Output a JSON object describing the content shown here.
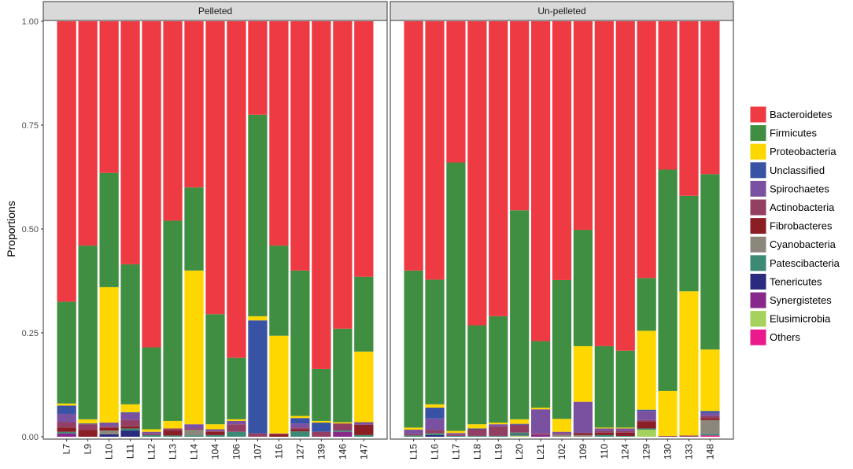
{
  "chart_data": {
    "type": "bar",
    "stacked": true,
    "ylabel": "Proportions",
    "xlabel": "",
    "ylim": [
      0,
      1
    ],
    "yticks": [
      "0.00",
      "0.25",
      "0.50",
      "0.75",
      "1.00"
    ],
    "grid": false,
    "legend_position": "right",
    "legend": [
      "Bacteroidetes",
      "Firmicutes",
      "Proteobacteria",
      "Unclassified",
      "Spirochaetes",
      "Actinobacteria",
      "Fibrobacteres",
      "Cyanobacteria",
      "Patescibacteria",
      "Tenericutes",
      "Synergistetes",
      "Elusimicrobia",
      "Others"
    ],
    "colors": {
      "Bacteroidetes": "#EE3A43",
      "Firmicutes": "#3F8E41",
      "Proteobacteria": "#FFD700",
      "Unclassified": "#3852A4",
      "Spirochaetes": "#7A51A1",
      "Actinobacteria": "#923F63",
      "Fibrobacteres": "#8A1E24",
      "Cyanobacteria": "#8C877D",
      "Patescibacteria": "#3C8A76",
      "Tenericutes": "#2A2A7E",
      "Synergistetes": "#87288A",
      "Elusimicrobia": "#A5D25C",
      "Others": "#EB1A8C"
    },
    "panels": [
      {
        "title": "Pelleted",
        "categories": [
          "L7",
          "L9",
          "L10",
          "L11",
          "L12",
          "L13",
          "L14",
          "104",
          "106",
          "107",
          "116",
          "127",
          "139",
          "146",
          "147"
        ],
        "series": [
          {
            "name": "Bacteroidetes",
            "values": [
              0.675,
              0.54,
              0.365,
              0.585,
              0.785,
              0.48,
              0.4,
              0.705,
              0.81,
              0.225,
              0.54,
              0.6,
              0.837,
              0.74,
              0.615
            ]
          },
          {
            "name": "Firmicutes",
            "values": [
              0.245,
              0.418,
              0.275,
              0.337,
              0.197,
              0.482,
              0.2,
              0.265,
              0.148,
              0.485,
              0.217,
              0.35,
              0.125,
              0.225,
              0.18
            ]
          },
          {
            "name": "Proteobacteria",
            "values": [
              0.005,
              0.01,
              0.326,
              0.019,
              0.006,
              0.018,
              0.37,
              0.012,
              0.004,
              0.01,
              0.235,
              0.005,
              0.004,
              0.003,
              0.17
            ]
          },
          {
            "name": "Unclassified",
            "values": [
              0.02,
              0.002,
              0,
              0.002,
              0,
              0,
              0,
              0,
              0,
              0.272,
              0,
              0.013,
              0.022,
              0,
              0
            ]
          },
          {
            "name": "Spirochaetes",
            "values": [
              0.02,
              0,
              0.009,
              0.017,
              0.004,
              0,
              0.01,
              0.004,
              0.008,
              0,
              0,
              0.01,
              0,
              0,
              0.006
            ]
          },
          {
            "name": "Actinobacteria",
            "values": [
              0.013,
              0.014,
              0.004,
              0.015,
              0.004,
              0.005,
              0.003,
              0.002,
              0.018,
              0.008,
              0.002,
              0.005,
              0.012,
              0.017,
              0
            ]
          },
          {
            "name": "Fibrobacteres",
            "values": [
              0.01,
              0.016,
              0.006,
              0.005,
              0,
              0.012,
              0,
              0.008,
              0,
              0,
              0.006,
              0.004,
              0,
              0,
              0.025
            ]
          },
          {
            "name": "Cyanobacteria",
            "values": [
              0,
              0,
              0.009,
              0,
              0,
              0,
              0.014,
              0,
              0,
              0,
              0,
              0,
              0,
              0,
              0
            ]
          },
          {
            "name": "Patescibacteria",
            "values": [
              0.004,
              0,
              0,
              0.005,
              0.004,
              0.003,
              0.003,
              0.004,
              0.012,
              0,
              0,
              0.013,
              0,
              0.003,
              0.004
            ]
          },
          {
            "name": "Tenericutes",
            "values": [
              0,
              0,
              0.006,
              0.015,
              0,
              0,
              0,
              0,
              0,
              0,
              0,
              0,
              0,
              0,
              0
            ]
          },
          {
            "name": "Synergistetes",
            "values": [
              0.008,
              0,
              0,
              0,
              0,
              0,
              0,
              0,
              0,
              0,
              0,
              0,
              0,
              0.012,
              0
            ]
          },
          {
            "name": "Elusimicrobia",
            "values": [
              0,
              0,
              0,
              0,
              0,
              0,
              0,
              0,
              0,
              0,
              0,
              0,
              0,
              0,
              0
            ]
          },
          {
            "name": "Others",
            "values": [
              0,
              0,
              0,
              0,
              0,
              0,
              0,
              0,
              0,
              0,
              0,
              0,
              0,
              0,
              0
            ]
          }
        ]
      },
      {
        "title": "Un-pelleted",
        "categories": [
          "L15",
          "L16",
          "L17",
          "L18",
          "L19",
          "L20",
          "L21",
          "102",
          "109",
          "110",
          "124",
          "129",
          "130",
          "133",
          "148"
        ],
        "series": [
          {
            "name": "Bacteroidetes",
            "values": [
              0.6,
              0.622,
              0.34,
              0.732,
              0.71,
              0.455,
              0.77,
              0.623,
              0.502,
              0.782,
              0.793,
              0.618,
              0.357,
              0.42,
              0.368
            ]
          },
          {
            "name": "Firmicutes",
            "values": [
              0.378,
              0.3,
              0.646,
              0.238,
              0.256,
              0.503,
              0.16,
              0.334,
              0.28,
              0.196,
              0.185,
              0.127,
              0.533,
              0.23,
              0.422
            ]
          },
          {
            "name": "Proteobacteria",
            "values": [
              0.005,
              0.008,
              0.005,
              0.01,
              0.004,
              0.011,
              0.004,
              0.031,
              0.134,
              0.002,
              0.002,
              0.19,
              0.108,
              0.347,
              0.148
            ]
          },
          {
            "name": "Unclassified",
            "values": [
              0,
              0.026,
              0,
              0.002,
              0,
              0.002,
              0,
              0,
              0,
              0,
              0,
              0.003,
              0,
              0,
              0.005
            ]
          },
          {
            "name": "Spirochaetes",
            "values": [
              0.01,
              0.028,
              0.004,
              0,
              0.005,
              0,
              0.058,
              0.004,
              0.075,
              0.006,
              0.006,
              0.022,
              0,
              0,
              0.007
            ]
          },
          {
            "name": "Actinobacteria",
            "values": [
              0.004,
              0.008,
              0.003,
              0.016,
              0.023,
              0.019,
              0.004,
              0.003,
              0,
              0.004,
              0.004,
              0.004,
              0.002,
              0.003,
              0.005
            ]
          },
          {
            "name": "Fibrobacteres",
            "values": [
              0,
              0,
              0,
              0,
              0,
              0,
              0,
              0,
              0.005,
              0.006,
              0.008,
              0.016,
              0,
              0,
              0.005
            ]
          },
          {
            "name": "Cyanobacteria",
            "values": [
              0,
              0,
              0,
              0,
              0,
              0,
              0,
              0.005,
              0.004,
              0,
              0,
              0,
              0,
              0,
              0.033
            ]
          },
          {
            "name": "Patescibacteria",
            "values": [
              0.003,
              0.004,
              0.002,
              0.002,
              0.002,
              0.005,
              0,
              0,
              0,
              0.004,
              0.002,
              0.003,
              0,
              0,
              0.004
            ]
          },
          {
            "name": "Tenericutes",
            "values": [
              0,
              0.004,
              0,
              0,
              0,
              0.002,
              0,
              0,
              0,
              0,
              0,
              0,
              0,
              0,
              0
            ]
          },
          {
            "name": "Synergistetes",
            "values": [
              0,
              0,
              0,
              0,
              0,
              0,
              0.004,
              0,
              0,
              0,
              0,
              0,
              0,
              0,
              0
            ]
          },
          {
            "name": "Elusimicrobia",
            "values": [
              0,
              0,
              0,
              0,
              0,
              0.003,
              0,
              0,
              0,
              0,
              0,
              0.017,
              0,
              0,
              0
            ]
          },
          {
            "name": "Others",
            "values": [
              0,
              0,
              0,
              0,
              0,
              0,
              0,
              0,
              0,
              0,
              0,
              0,
              0,
              0,
              0.003
            ]
          }
        ]
      }
    ]
  }
}
